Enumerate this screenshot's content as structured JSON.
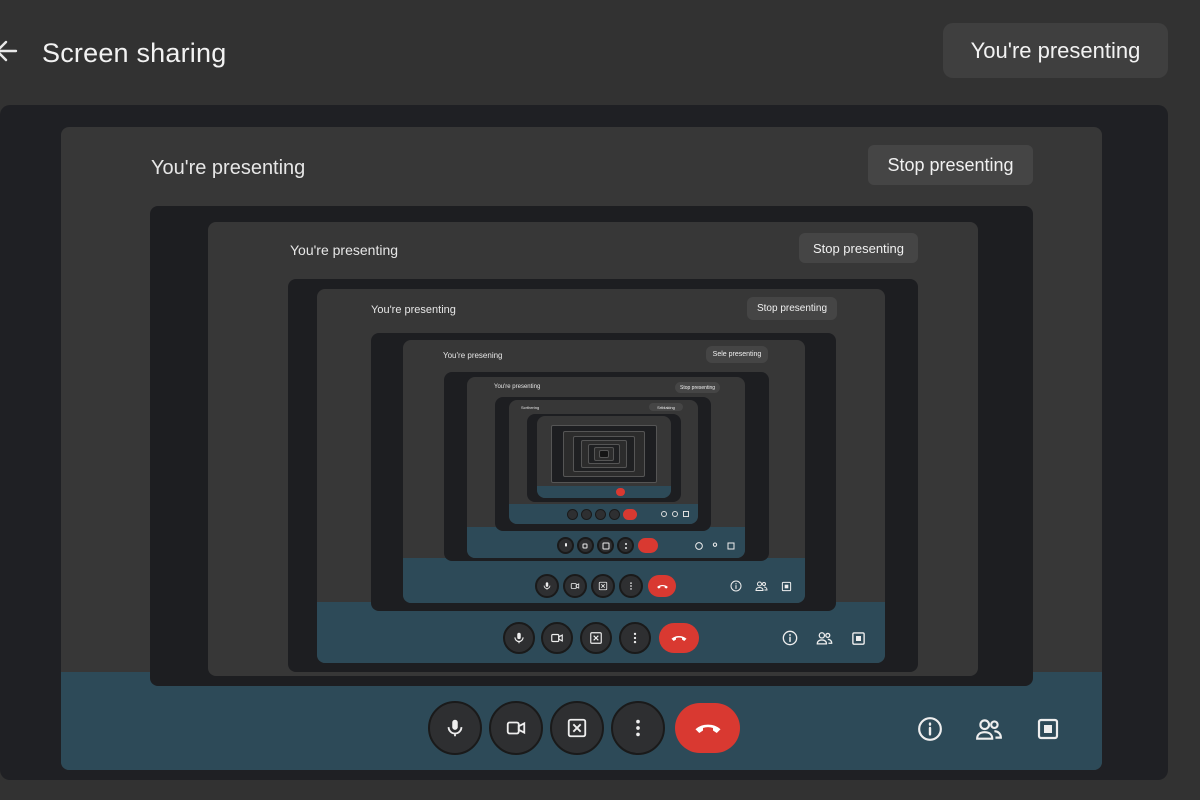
{
  "header": {
    "title": "Screen sharing",
    "presenting_chip": "You're presenting"
  },
  "levels": [
    {
      "label": "You're presenting",
      "stop": "Stop presenting"
    },
    {
      "label": "You're presenting",
      "stop": "Stop presenting"
    },
    {
      "label": "You're presenting",
      "stop": "Stop presenting"
    },
    {
      "label": "You're presening",
      "stop": "Sele presenting"
    },
    {
      "label": "You're presenting",
      "stop": "Stop presenting"
    },
    {
      "label": "Scrthering",
      "stop": "Srtblaking"
    }
  ],
  "controls": {
    "icons": [
      "microphone-icon",
      "camera-icon",
      "present-stop-icon",
      "more-vert-icon",
      "hang-up-icon"
    ],
    "side_icons": [
      "info-icon",
      "people-icon",
      "activities-icon"
    ],
    "end_call_color": "#d93931",
    "bar_color": "#2d4a58"
  }
}
